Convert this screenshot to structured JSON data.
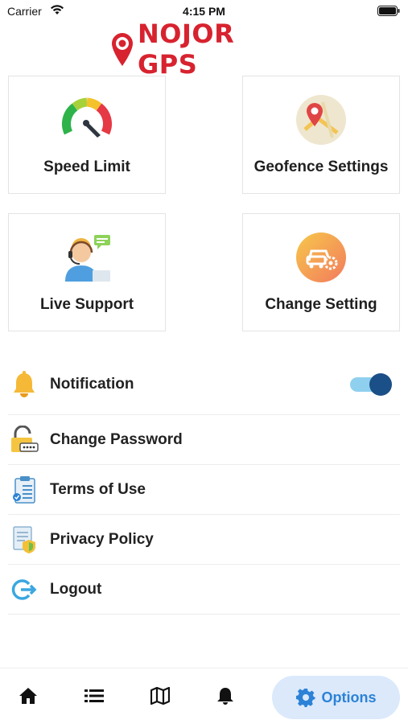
{
  "status_bar": {
    "carrier": "Carrier",
    "time": "4:15 PM"
  },
  "app": {
    "brand": "NOJOR GPS",
    "brand_color": "#d7232f"
  },
  "tiles": [
    {
      "label": "Speed Limit",
      "icon": "speedometer-icon"
    },
    {
      "label": "Geofence Settings",
      "icon": "map-pin-icon"
    },
    {
      "label": "Live Support",
      "icon": "support-agent-icon"
    },
    {
      "label": "Change Setting",
      "icon": "car-settings-icon"
    }
  ],
  "menu": [
    {
      "label": "Notification",
      "icon": "bell-icon",
      "toggle": true
    },
    {
      "label": "Change Password",
      "icon": "lock-icon"
    },
    {
      "label": "Terms of Use",
      "icon": "clipboard-icon"
    },
    {
      "label": "Privacy Policy",
      "icon": "shield-document-icon"
    },
    {
      "label": "Logout",
      "icon": "logout-icon"
    }
  ],
  "bottom_nav": {
    "items": [
      "home-icon",
      "list-icon",
      "map-icon",
      "bell-icon"
    ],
    "active_label": "Options",
    "active_icon": "gear-icon",
    "accent": "#2c82d6"
  }
}
